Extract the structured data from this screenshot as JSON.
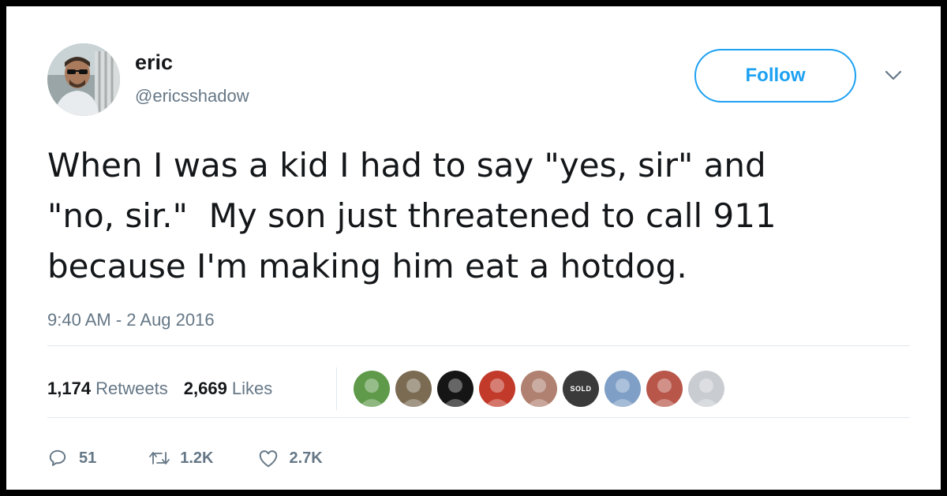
{
  "user": {
    "name": "eric",
    "handle": "@ericsshadow",
    "avatar_icon": "person-photo-avatar"
  },
  "follow": {
    "label": "Follow",
    "color": "#1da1f2"
  },
  "tweet": {
    "lines": [
      "When I was a kid I had to say \"yes, sir\" and",
      "\"no, sir.\"  My son just threatened to call 911",
      "because I'm making him eat a hotdog."
    ],
    "timestamp": "9:40 AM - 2 Aug 2016"
  },
  "stats": {
    "retweets_count": "1,174",
    "retweets_label": "Retweets",
    "likes_count": "2,669",
    "likes_label": "Likes"
  },
  "likers": [
    {
      "icon": "liker-avatar-green",
      "color": "#5f9a4a"
    },
    {
      "icon": "liker-avatar-face",
      "color": "#7a6b52"
    },
    {
      "icon": "liker-avatar-dark",
      "color": "#151515"
    },
    {
      "icon": "liker-avatar-red",
      "color": "#c23a2a"
    },
    {
      "icon": "liker-avatar-woman",
      "color": "#b08070"
    },
    {
      "icon": "liker-avatar-sold-logo",
      "color": "#3a3a3a",
      "text": "SOLD"
    },
    {
      "icon": "liker-avatar-blue",
      "color": "#7f9fc6"
    },
    {
      "icon": "liker-avatar-redhair",
      "color": "#b8564a"
    },
    {
      "icon": "liker-avatar-man",
      "color": "#c9cdd2"
    }
  ],
  "actions": {
    "reply_count": "51",
    "retweet_count": "1.2K",
    "like_count": "2.7K"
  },
  "colors": {
    "text_primary": "#14171a",
    "text_secondary": "#657786",
    "divider": "#e1e8ed",
    "accent": "#1da1f2"
  }
}
